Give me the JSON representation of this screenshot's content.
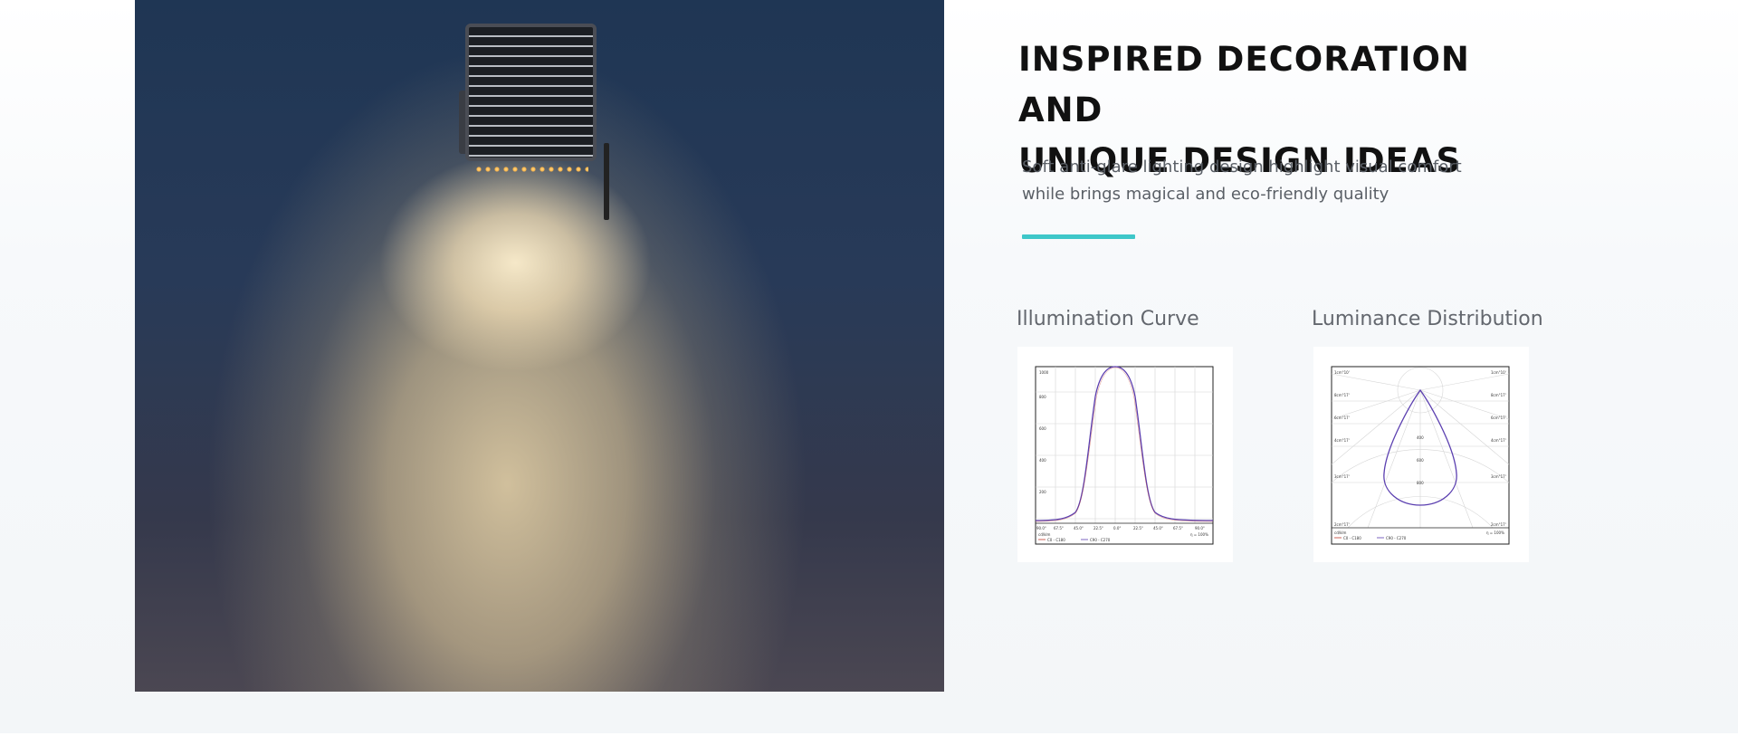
{
  "hero": {
    "heading_line1": "INSPIRED DECORATION AND",
    "heading_line2": "UNIQUE DESIGN IDEAS",
    "description_line1": "Soft anti-glare lighting design highlight visual comfort",
    "description_line2": "while brings magical and eco-friendly quality",
    "accent_color": "#3ec7c9"
  },
  "diagrams": {
    "illumination": {
      "caption": "Illumination Curve",
      "y_ticks": [
        "1000",
        "800",
        "600",
        "400",
        "200"
      ],
      "x_ticks": [
        "90.0°",
        "67.5°",
        "45.0°",
        "22.5°",
        "0.0°",
        "22.5°",
        "45.0°",
        "67.5°",
        "90.0°"
      ],
      "unit": "cd/klm",
      "efficiency": "η = 100%",
      "legend_1": "C0 - C180",
      "legend_2": "C90 - C270",
      "curve_color": "#5b3fb0"
    },
    "luminance": {
      "caption": "Luminance Distribution",
      "left_labels": [
        "1cm°10'",
        "8cm°17'",
        "6cm°17'",
        "4cm°17'",
        "3cm°17'",
        "2cm°17'"
      ],
      "right_labels": [
        "1cm°10'",
        "8cm°17'",
        "6cm°17'",
        "4cm°17'",
        "3cm°17'",
        "2cm°17'"
      ],
      "ring_labels": [
        "400",
        "600",
        "800"
      ],
      "unit": "cd/klm",
      "efficiency": "η = 100%",
      "legend_1": "C0 - C180",
      "legend_2": "C90 - C270",
      "curve_color": "#5b3fb0"
    }
  }
}
